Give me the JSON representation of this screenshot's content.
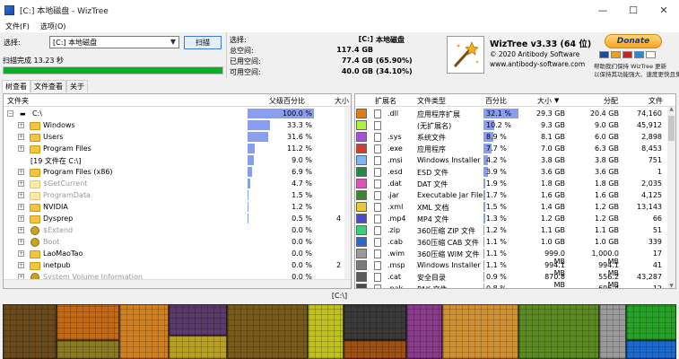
{
  "window": {
    "title": "[C:] 本地磁盘  - WizTree",
    "controls": [
      "—",
      "☐",
      "✕"
    ]
  },
  "menu": [
    "文件(F)",
    "选项(O)"
  ],
  "scan": {
    "select_label": "选择:",
    "drive_value": "[C:] 本地磁盘",
    "scan_button": "扫描",
    "status": "扫描完成 13.23 秒",
    "progress": 1.0
  },
  "drive_stats": {
    "rows": [
      {
        "label": "选择:",
        "value": "[C:]",
        "extra": "本地磁盘"
      },
      {
        "label": "总空间:",
        "value": "117.4 GB",
        "extra": ""
      },
      {
        "label": "已用空间:",
        "value": "77.4 GB",
        "extra": "(65.90%)"
      },
      {
        "label": "可用空间:",
        "value": "40.0 GB",
        "extra": "(34.10%)"
      }
    ]
  },
  "about": {
    "title": "WizTree v3.33 (64 位)",
    "copyright": "© 2020 Antibody Software",
    "url": "www.antibody-software.com",
    "donate": "Donate",
    "donate_note_1": "帮助我们保持 WizTree 更新",
    "donate_note_2": "以保持其功能强大、速度更快且免费"
  },
  "tabs": [
    "树查看",
    "文件查看",
    "关于"
  ],
  "tree": {
    "headers": {
      "name": "文件夹",
      "pct": "父级百分比",
      "size": "大小"
    },
    "rows": [
      {
        "name": "C:\\",
        "pct": "100.0 %",
        "frac": 1.0,
        "size": "",
        "icon": "drive",
        "dim": false,
        "root": true
      },
      {
        "name": "Windows",
        "pct": "33.3 %",
        "frac": 0.333,
        "size": "",
        "icon": "folder",
        "dim": false
      },
      {
        "name": "Users",
        "pct": "31.6 %",
        "frac": 0.316,
        "size": "",
        "icon": "folder",
        "dim": false
      },
      {
        "name": "Program Files",
        "pct": "11.2 %",
        "frac": 0.112,
        "size": "",
        "icon": "folder",
        "dim": false
      },
      {
        "name": "[19 文件在 C:\\]",
        "pct": "9.0 %",
        "frac": 0.09,
        "size": "",
        "icon": "none",
        "dim": false
      },
      {
        "name": "Program Files (x86)",
        "pct": "6.9 %",
        "frac": 0.069,
        "size": "",
        "icon": "folder",
        "dim": false
      },
      {
        "name": "$GetCurrent",
        "pct": "4.7 %",
        "frac": 0.047,
        "size": "",
        "icon": "folder",
        "dim": true
      },
      {
        "name": "ProgramData",
        "pct": "1.5 %",
        "frac": 0.015,
        "size": "",
        "icon": "folder",
        "dim": true
      },
      {
        "name": "NVIDIA",
        "pct": "1.2 %",
        "frac": 0.012,
        "size": "",
        "icon": "folder",
        "dim": false
      },
      {
        "name": "Dysprep",
        "pct": "0.5 %",
        "frac": 0.005,
        "size": "4",
        "icon": "folder",
        "dim": false
      },
      {
        "name": "$Extend",
        "pct": "0.0 %",
        "frac": 0.0,
        "size": "",
        "icon": "gear",
        "dim": true
      },
      {
        "name": "Boot",
        "pct": "0.0 %",
        "frac": 0.0,
        "size": "",
        "icon": "gear",
        "dim": true
      },
      {
        "name": "LaoMaoTao",
        "pct": "0.0 %",
        "frac": 0.0,
        "size": "",
        "icon": "folder",
        "dim": false
      },
      {
        "name": "inetpub",
        "pct": "0.0 %",
        "frac": 0.0,
        "size": "2",
        "icon": "folder",
        "dim": false
      },
      {
        "name": "System Volume Information",
        "pct": "0.0 %",
        "frac": 0.0,
        "size": "",
        "icon": "gear",
        "dim": true
      }
    ]
  },
  "extensions": {
    "headers": {
      "ext": "扩展名",
      "type": "文件类型",
      "pct": "百分比",
      "size": "大小",
      "alloc": "分配",
      "files": "文件"
    },
    "rows": [
      {
        "color": "#e07a1f",
        "ext": ".dll",
        "type": "应用程序扩展",
        "pct": "32.1 %",
        "frac": 0.321,
        "size": "29.3 GB",
        "alloc": "20.4 GB",
        "files": "74,160"
      },
      {
        "color": "#b2f03a",
        "ext": "",
        "type": "(无扩展名)",
        "pct": "10.2 %",
        "frac": 0.102,
        "size": "9.3 GB",
        "alloc": "9.0 GB",
        "files": "45,912"
      },
      {
        "color": "#a64fd9",
        "ext": ".sys",
        "type": "系统文件",
        "pct": "8.9 %",
        "frac": 0.089,
        "size": "8.1 GB",
        "alloc": "6.0 GB",
        "files": "2,898"
      },
      {
        "color": "#d83a2a",
        "ext": ".exe",
        "type": "应用程序",
        "pct": "7.7 %",
        "frac": 0.077,
        "size": "7.0 GB",
        "alloc": "6.3 GB",
        "files": "8,453"
      },
      {
        "color": "#7fb5f5",
        "ext": ".msi",
        "type": "Windows Installer",
        "pct": "4.2 %",
        "frac": 0.042,
        "size": "3.8 GB",
        "alloc": "3.8 GB",
        "files": "751"
      },
      {
        "color": "#1f8a4a",
        "ext": ".esd",
        "type": "ESD 文件",
        "pct": "3.9 %",
        "frac": 0.039,
        "size": "3.6 GB",
        "alloc": "3.6 GB",
        "files": "1"
      },
      {
        "color": "#e050c0",
        "ext": ".dat",
        "type": "DAT 文件",
        "pct": "1.9 %",
        "frac": 0.019,
        "size": "1.8 GB",
        "alloc": "1.8 GB",
        "files": "2,035"
      },
      {
        "color": "#3a8a2a",
        "ext": ".jar",
        "type": "Executable Jar File",
        "pct": "1.7 %",
        "frac": 0.017,
        "size": "1.6 GB",
        "alloc": "1.6 GB",
        "files": "4,125"
      },
      {
        "color": "#e5c93a",
        "ext": ".xml",
        "type": "XML 文档",
        "pct": "1.5 %",
        "frac": 0.015,
        "size": "1.4 GB",
        "alloc": "1.2 GB",
        "files": "13,143"
      },
      {
        "color": "#4a4ad0",
        "ext": ".mp4",
        "type": "MP4 文件",
        "pct": "1.3 %",
        "frac": 0.013,
        "size": "1.2 GB",
        "alloc": "1.2 GB",
        "files": "66"
      },
      {
        "color": "#3ad07a",
        "ext": ".zip",
        "type": "360压缩 ZIP 文件",
        "pct": "1.2 %",
        "frac": 0.012,
        "size": "1.1 GB",
        "alloc": "1.1 GB",
        "files": "51"
      },
      {
        "color": "#2a6ad0",
        "ext": ".cab",
        "type": "360压缩 CAB 文件",
        "pct": "1.1 %",
        "frac": 0.011,
        "size": "1.0 GB",
        "alloc": "1.0 GB",
        "files": "339"
      },
      {
        "color": "#9a9a9a",
        "ext": ".wim",
        "type": "360压缩 WIM 文件",
        "pct": "1.1 %",
        "frac": 0.011,
        "size": "999.0 MB",
        "alloc": "1,000.0 MB",
        "files": "17"
      },
      {
        "color": "#7a7a7a",
        "ext": ".msp",
        "type": "Windows Installer",
        "pct": "1.1 %",
        "frac": 0.011,
        "size": "994.1 MB",
        "alloc": "994.1 MB",
        "files": "41"
      },
      {
        "color": "#5a5a5a",
        "ext": ".cat",
        "type": "安全目录",
        "pct": "0.9 %",
        "frac": 0.009,
        "size": "870.8 MB",
        "alloc": "556.2 MB",
        "files": "43,287"
      },
      {
        "color": "#4a4a4a",
        "ext": ".pak",
        "type": "PAK 文件",
        "pct": "0.8 %",
        "frac": 0.008,
        "size": "",
        "alloc": "696.4 MB",
        "files": "12"
      }
    ]
  },
  "path_bar": "[C:\\]",
  "treemap": {
    "blocks": [
      {
        "color": "#6a4a1a"
      },
      {
        "color": "#c06a18"
      },
      {
        "color": "#8a7a20"
      },
      {
        "color": "#d08020"
      },
      {
        "color": "#5a3a6a"
      },
      {
        "color": "#b8a020"
      },
      {
        "color": "#7a5a18"
      },
      {
        "color": "#c0c020"
      },
      {
        "color": "#3a3a3a"
      },
      {
        "color": "#a05010"
      },
      {
        "color": "#8a3a8a"
      },
      {
        "color": "#d09030"
      },
      {
        "color": "#5a8a20"
      },
      {
        "color": "#9a9a9a"
      },
      {
        "color": "#2aa02a"
      },
      {
        "color": "#1a6ad0"
      }
    ]
  }
}
